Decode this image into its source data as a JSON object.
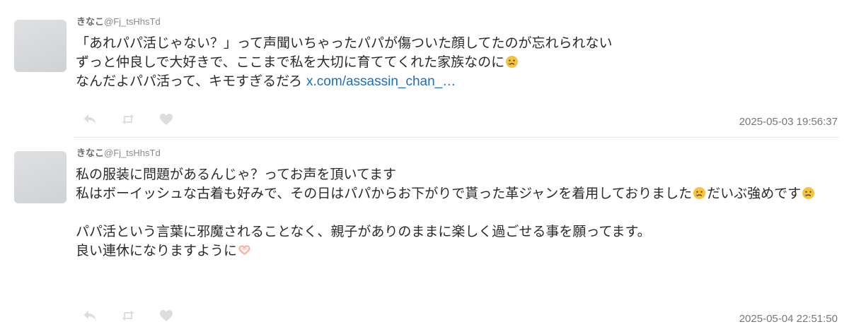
{
  "tweets": [
    {
      "display_name": "きなこ",
      "handle": "@Fj_tsHhsTd",
      "lines": [
        "「あれパパ活じゃない？」って声聞いちゃったパパが傷ついた顔してたのが忘れられない",
        "ずっと仲良しで大好きで、ここまで私を大切に育ててくれた家族なのに",
        "なんだよパパ活って、キモすぎるだろ "
      ],
      "link_text": "x.com/assassin_chan_…",
      "timestamp": "2025-05-03 19:56:37",
      "icons": {
        "reply": "reply-icon",
        "retweet": "retweet-icon",
        "like": "heart-icon"
      }
    },
    {
      "display_name": "きなこ",
      "handle": "@Fj_tsHhsTd",
      "lines": [
        "私の服装に問題があるんじゃ？ってお声を頂いてます",
        "私はボーイッシュな古着も好みで、その日はパパからお下がりで貰った革ジャンを着用しておりました",
        "だいぶ強めです",
        "",
        "パパ活という言葉に邪魔されることなく、親子がありのままに楽しく過ごせる事を願ってます。",
        "良い連休になりますように"
      ],
      "timestamp": "2025-05-04 22:51:50",
      "icons": {
        "reply": "reply-icon",
        "retweet": "retweet-icon",
        "like": "heart-icon"
      }
    }
  ],
  "emojis": {
    "crying_face": "crying-face-emoji",
    "heart_hands": "heart-hands-emoji"
  },
  "colors": {
    "link": "#1a6fbf",
    "action_icon": "#dddddd",
    "timestamp": "#777777",
    "divider": "#e6e6e6"
  }
}
